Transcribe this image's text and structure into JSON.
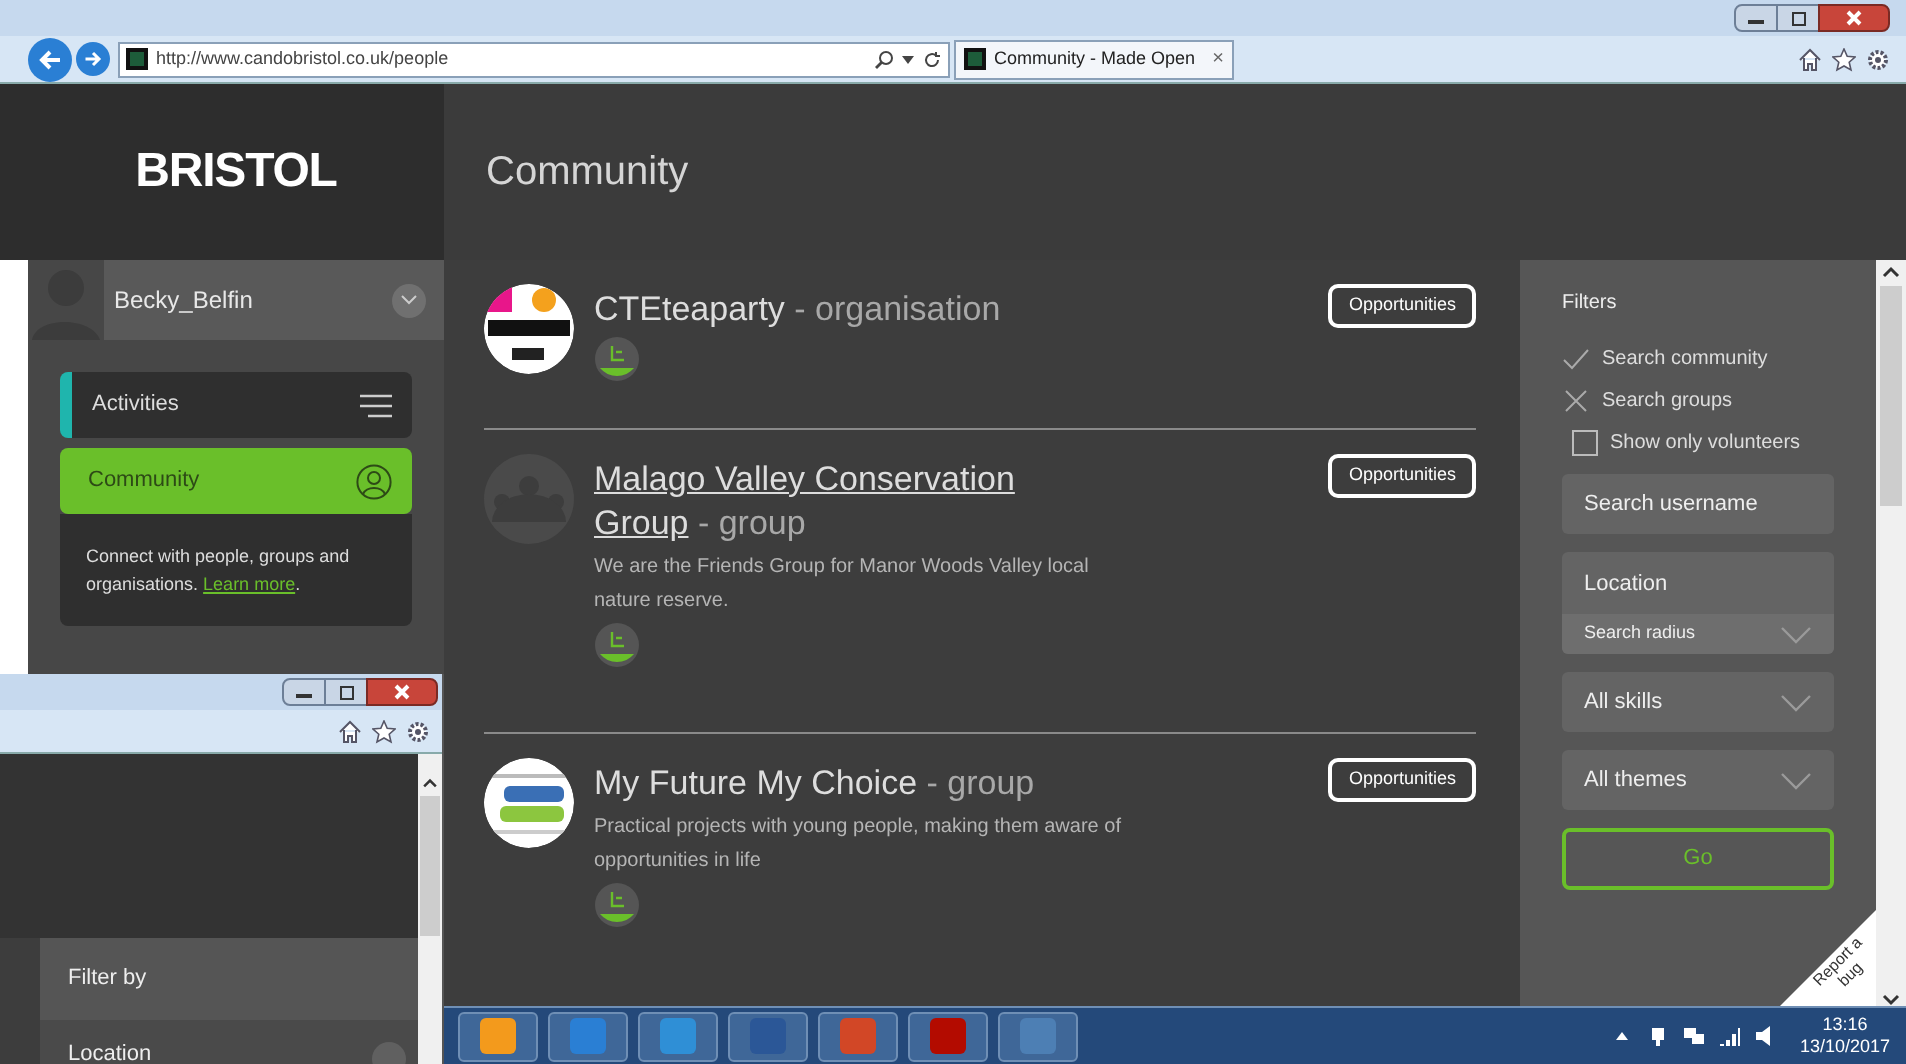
{
  "browser": {
    "address": "http://www.candobristol.co.uk/people",
    "tab_title": "Community - Made Open",
    "tab_close": "×"
  },
  "sidebar": {
    "logo": "BRISTOL",
    "username": "Becky_Belfin",
    "nav": [
      {
        "label": "Activities",
        "selected": false,
        "kind": "menu"
      },
      {
        "label": "Community",
        "selected": true,
        "kind": "person"
      }
    ],
    "description": "Connect with people, groups and organisations. ",
    "link": "Learn more",
    "description_end": "."
  },
  "page_title": "Community",
  "results": [
    {
      "name": "CTEteaparty",
      "type": " - organisation",
      "linked": false,
      "kind": "picture",
      "button": "Opportunities"
    },
    {
      "name": "Malago Valley Conservation Group",
      "type": " - group",
      "linked": true,
      "kind": "placeholder",
      "description": "We are the Friends Group for Manor Woods Valley local nature reserve.",
      "button": "Opportunities"
    },
    {
      "name": "My Future My Choice",
      "type": " - group",
      "linked": false,
      "kind": "picture",
      "description": "Practical projects with young people, making them aware of opportunities in life",
      "button": "Opportunities"
    }
  ],
  "filters": {
    "title": "Filters",
    "options": [
      {
        "label": "Search community",
        "kind": "tick"
      },
      {
        "label": "Search groups",
        "kind": "cross"
      },
      {
        "label": "Show only volunteers",
        "kind": "checkbox",
        "checked": false
      }
    ],
    "username_placeholder": "Search username",
    "location_placeholder": "Location",
    "radius": "Search radius",
    "selects": [
      "All skills",
      "All themes"
    ],
    "go": "Go",
    "report": "Report a bug"
  },
  "second_window": {
    "filter_by": "Filter by",
    "location": "Location"
  },
  "taskbar": {
    "time": "13:16",
    "date": "13/10/2017"
  }
}
